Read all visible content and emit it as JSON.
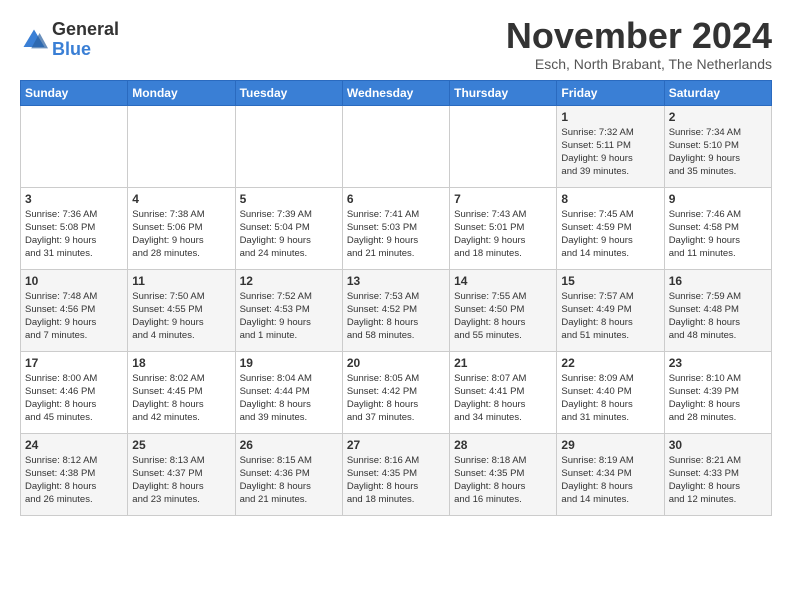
{
  "logo": {
    "general": "General",
    "blue": "Blue"
  },
  "title": "November 2024",
  "subtitle": "Esch, North Brabant, The Netherlands",
  "headers": [
    "Sunday",
    "Monday",
    "Tuesday",
    "Wednesday",
    "Thursday",
    "Friday",
    "Saturday"
  ],
  "weeks": [
    [
      {
        "day": "",
        "info": ""
      },
      {
        "day": "",
        "info": ""
      },
      {
        "day": "",
        "info": ""
      },
      {
        "day": "",
        "info": ""
      },
      {
        "day": "",
        "info": ""
      },
      {
        "day": "1",
        "info": "Sunrise: 7:32 AM\nSunset: 5:11 PM\nDaylight: 9 hours\nand 39 minutes."
      },
      {
        "day": "2",
        "info": "Sunrise: 7:34 AM\nSunset: 5:10 PM\nDaylight: 9 hours\nand 35 minutes."
      }
    ],
    [
      {
        "day": "3",
        "info": "Sunrise: 7:36 AM\nSunset: 5:08 PM\nDaylight: 9 hours\nand 31 minutes."
      },
      {
        "day": "4",
        "info": "Sunrise: 7:38 AM\nSunset: 5:06 PM\nDaylight: 9 hours\nand 28 minutes."
      },
      {
        "day": "5",
        "info": "Sunrise: 7:39 AM\nSunset: 5:04 PM\nDaylight: 9 hours\nand 24 minutes."
      },
      {
        "day": "6",
        "info": "Sunrise: 7:41 AM\nSunset: 5:03 PM\nDaylight: 9 hours\nand 21 minutes."
      },
      {
        "day": "7",
        "info": "Sunrise: 7:43 AM\nSunset: 5:01 PM\nDaylight: 9 hours\nand 18 minutes."
      },
      {
        "day": "8",
        "info": "Sunrise: 7:45 AM\nSunset: 4:59 PM\nDaylight: 9 hours\nand 14 minutes."
      },
      {
        "day": "9",
        "info": "Sunrise: 7:46 AM\nSunset: 4:58 PM\nDaylight: 9 hours\nand 11 minutes."
      }
    ],
    [
      {
        "day": "10",
        "info": "Sunrise: 7:48 AM\nSunset: 4:56 PM\nDaylight: 9 hours\nand 7 minutes."
      },
      {
        "day": "11",
        "info": "Sunrise: 7:50 AM\nSunset: 4:55 PM\nDaylight: 9 hours\nand 4 minutes."
      },
      {
        "day": "12",
        "info": "Sunrise: 7:52 AM\nSunset: 4:53 PM\nDaylight: 9 hours\nand 1 minute."
      },
      {
        "day": "13",
        "info": "Sunrise: 7:53 AM\nSunset: 4:52 PM\nDaylight: 8 hours\nand 58 minutes."
      },
      {
        "day": "14",
        "info": "Sunrise: 7:55 AM\nSunset: 4:50 PM\nDaylight: 8 hours\nand 55 minutes."
      },
      {
        "day": "15",
        "info": "Sunrise: 7:57 AM\nSunset: 4:49 PM\nDaylight: 8 hours\nand 51 minutes."
      },
      {
        "day": "16",
        "info": "Sunrise: 7:59 AM\nSunset: 4:48 PM\nDaylight: 8 hours\nand 48 minutes."
      }
    ],
    [
      {
        "day": "17",
        "info": "Sunrise: 8:00 AM\nSunset: 4:46 PM\nDaylight: 8 hours\nand 45 minutes."
      },
      {
        "day": "18",
        "info": "Sunrise: 8:02 AM\nSunset: 4:45 PM\nDaylight: 8 hours\nand 42 minutes."
      },
      {
        "day": "19",
        "info": "Sunrise: 8:04 AM\nSunset: 4:44 PM\nDaylight: 8 hours\nand 39 minutes."
      },
      {
        "day": "20",
        "info": "Sunrise: 8:05 AM\nSunset: 4:42 PM\nDaylight: 8 hours\nand 37 minutes."
      },
      {
        "day": "21",
        "info": "Sunrise: 8:07 AM\nSunset: 4:41 PM\nDaylight: 8 hours\nand 34 minutes."
      },
      {
        "day": "22",
        "info": "Sunrise: 8:09 AM\nSunset: 4:40 PM\nDaylight: 8 hours\nand 31 minutes."
      },
      {
        "day": "23",
        "info": "Sunrise: 8:10 AM\nSunset: 4:39 PM\nDaylight: 8 hours\nand 28 minutes."
      }
    ],
    [
      {
        "day": "24",
        "info": "Sunrise: 8:12 AM\nSunset: 4:38 PM\nDaylight: 8 hours\nand 26 minutes."
      },
      {
        "day": "25",
        "info": "Sunrise: 8:13 AM\nSunset: 4:37 PM\nDaylight: 8 hours\nand 23 minutes."
      },
      {
        "day": "26",
        "info": "Sunrise: 8:15 AM\nSunset: 4:36 PM\nDaylight: 8 hours\nand 21 minutes."
      },
      {
        "day": "27",
        "info": "Sunrise: 8:16 AM\nSunset: 4:35 PM\nDaylight: 8 hours\nand 18 minutes."
      },
      {
        "day": "28",
        "info": "Sunrise: 8:18 AM\nSunset: 4:35 PM\nDaylight: 8 hours\nand 16 minutes."
      },
      {
        "day": "29",
        "info": "Sunrise: 8:19 AM\nSunset: 4:34 PM\nDaylight: 8 hours\nand 14 minutes."
      },
      {
        "day": "30",
        "info": "Sunrise: 8:21 AM\nSunset: 4:33 PM\nDaylight: 8 hours\nand 12 minutes."
      }
    ]
  ]
}
